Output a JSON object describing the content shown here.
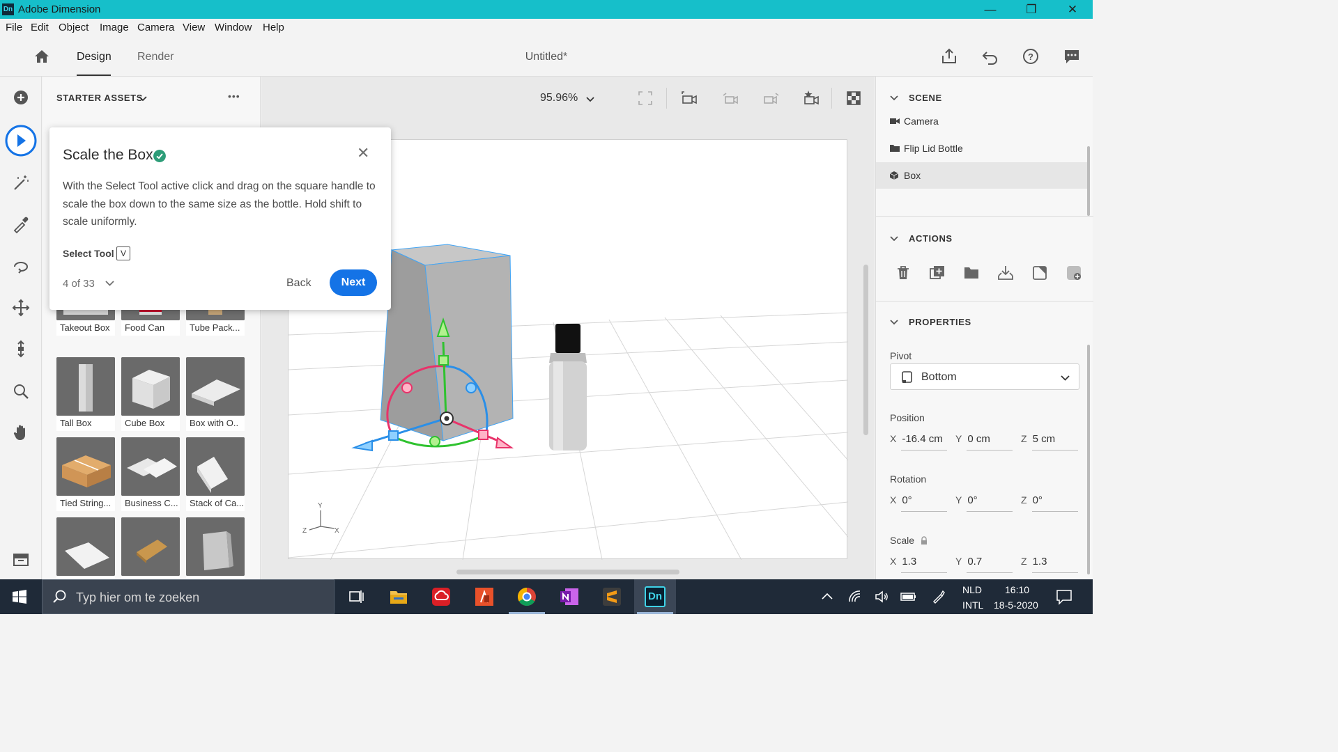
{
  "window": {
    "app_logo": "Dn",
    "title": "Adobe Dimension",
    "controls": {
      "minimize": "—",
      "restore": "❐",
      "close": "✕"
    }
  },
  "menu": [
    "File",
    "Edit",
    "Object",
    "Image",
    "Camera",
    "View",
    "Window",
    "Help"
  ],
  "topbar": {
    "tabs": [
      {
        "label": "Design",
        "active": true
      },
      {
        "label": "Render",
        "active": false
      }
    ],
    "document_title": "Untitled*",
    "icons": [
      "home-icon",
      "share-icon",
      "undo-icon",
      "help-icon",
      "feedback-icon"
    ]
  },
  "tools": [
    "add-icon",
    "select-tool-icon",
    "magic-wand-icon",
    "eyedropper-icon",
    "orbit-icon",
    "pan-icon",
    "dolly-icon",
    "zoom-icon",
    "hand-icon",
    "panel-toggle-icon"
  ],
  "assets": {
    "title": "STARTER ASSETS",
    "more": "•••",
    "items": [
      {
        "label": "Takeout Box"
      },
      {
        "label": "Food Can"
      },
      {
        "label": "Tube Pack..."
      },
      {
        "label": "Tall Box"
      },
      {
        "label": "Cube Box"
      },
      {
        "label": "Box with O.."
      },
      {
        "label": "Tied String..."
      },
      {
        "label": "Business C..."
      },
      {
        "label": "Stack of Ca..."
      },
      {
        "label": ""
      },
      {
        "label": ""
      },
      {
        "label": ""
      }
    ]
  },
  "viewport": {
    "zoom": "95.96%",
    "axis_labels": {
      "y": "Y",
      "x": "X",
      "z": "Z"
    }
  },
  "tutorial": {
    "title": "Scale the Box",
    "body": "With the Select Tool active click and drag on the square handle to scale the box down to the same size as the bottle. Hold shift to scale uniformly.",
    "tool_label": "Select Tool",
    "tool_key": "V",
    "step": "4 of 33",
    "back_label": "Back",
    "next_label": "Next",
    "close": "✕"
  },
  "scene": {
    "title": "SCENE",
    "items": [
      {
        "label": "Camera",
        "icon": "camera-icon",
        "selected": false
      },
      {
        "label": "Flip Lid Bottle",
        "icon": "folder-icon",
        "selected": false
      },
      {
        "label": "Box",
        "icon": "cube-icon",
        "selected": true
      }
    ]
  },
  "actions": {
    "title": "ACTIONS",
    "icons": [
      "delete-icon",
      "duplicate-icon",
      "group-icon",
      "drop-to-ground-icon",
      "export-selected-icon",
      "place-image-icon"
    ]
  },
  "properties": {
    "title": "PROPERTIES",
    "pivot_label": "Pivot",
    "pivot_value": "Bottom",
    "position_label": "Position",
    "position": {
      "x": "-16.4 cm",
      "y": "0 cm",
      "z": "5 cm"
    },
    "rotation_label": "Rotation",
    "rotation": {
      "x": "0°",
      "y": "0°",
      "z": "0°"
    },
    "scale_label": "Scale",
    "scale": {
      "x": "1.3",
      "y": "0.7",
      "z": "1.3"
    },
    "axis": {
      "x": "X",
      "y": "Y",
      "z": "Z"
    }
  },
  "taskbar": {
    "search_placeholder": "Typ hier om te zoeken",
    "apps": [
      "task-view-icon",
      "file-explorer-icon",
      "creative-cloud-icon",
      "acrobat-icon",
      "chrome-icon",
      "onenote-icon",
      "sublime-icon",
      "dimension-icon"
    ],
    "active_app_label": "Dn",
    "lang_top": "NLD",
    "lang_bottom": "INTL",
    "time": "16:10",
    "date": "18-5-2020"
  },
  "colors": {
    "titlebar": "#16bfca",
    "accent_blue": "#1473e6",
    "check_green": "#2d9d78",
    "gizmo_green": "#2fc22f",
    "gizmo_blue": "#2a8fe8",
    "gizmo_red": "#e8336a"
  }
}
